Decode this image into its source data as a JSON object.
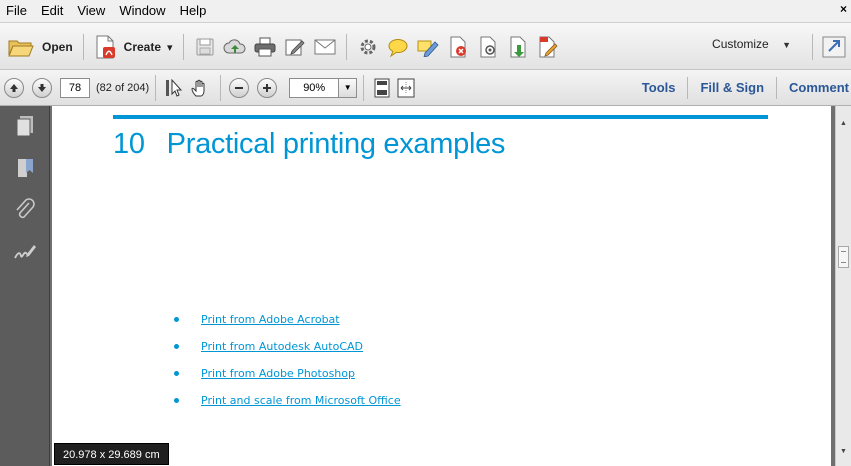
{
  "menu": {
    "items": [
      {
        "label": "File"
      },
      {
        "label": "Edit"
      },
      {
        "label": "View"
      },
      {
        "label": "Window"
      },
      {
        "label": "Help"
      }
    ],
    "close_glyph": "×"
  },
  "toolbar": {
    "open_label": "Open",
    "create_label": "Create",
    "create_caret": "▾",
    "customize_label": "Customize",
    "customize_caret": "▼",
    "icons": [
      "save-icon",
      "cloud-upload-icon",
      "print-icon",
      "edit-icon",
      "email-icon",
      "gear-icon",
      "comment-icon",
      "highlight-icon",
      "pdf-redact-icon",
      "pdf-protect-icon",
      "pdf-export-icon",
      "pdf-sign-icon"
    ]
  },
  "navigation": {
    "current_page": "78",
    "page_count": "(82 of 204)",
    "zoom_value": "90%",
    "zoom_caret": "▼"
  },
  "panels": {
    "tools": "Tools",
    "fill_sign": "Fill & Sign",
    "comment": "Comment"
  },
  "leftnav": {
    "icons": [
      "page-thumbnails-icon",
      "bookmarks-icon",
      "attachments-icon",
      "signatures-icon"
    ]
  },
  "document": {
    "chapter_number": "10",
    "chapter_title": "Practical printing examples",
    "links": [
      {
        "text": "Print from Adobe Acrobat"
      },
      {
        "text": "Print from Autodesk AutoCAD"
      },
      {
        "text": "Print from Adobe Photoshop"
      },
      {
        "text": "Print and scale from Microsoft Office"
      }
    ]
  },
  "status": {
    "page_size": "20.978 x 29.689 cm"
  },
  "colors": {
    "accent": "#0096d6",
    "panel_link": "#2b5797",
    "nav_pane": "#5c5c5c"
  }
}
